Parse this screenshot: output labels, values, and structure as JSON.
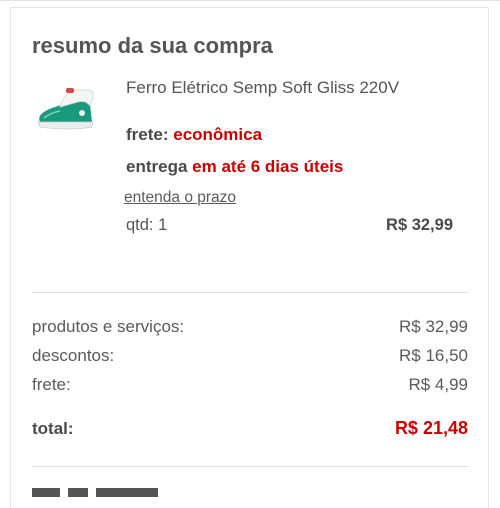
{
  "summary": {
    "title": "resumo da sua compra",
    "product": {
      "image_icon": "steam-iron-icon",
      "name": "Ferro Elétrico Semp Soft Gliss 220V",
      "shipping_label": "frete:",
      "shipping_value": "econômica",
      "delivery_label": "entrega",
      "delivery_value": "em até 6 dias úteis",
      "deadline_link": "entenda o prazo",
      "quantity": "qtd: 1",
      "price": "R$ 32,99"
    },
    "totals": {
      "products_label": "produtos e serviços:",
      "products_value": "R$ 32,99",
      "discounts_label": "descontos:",
      "discounts_value": "R$ 16,50",
      "freight_label": "frete:",
      "freight_value": "R$ 4,99",
      "total_label": "total:",
      "total_value": "R$ 21,48"
    }
  },
  "colors": {
    "accent_red": "#cc0000",
    "text": "#555555",
    "divider": "#dddddd",
    "iron_green": "#1a9a7c"
  }
}
